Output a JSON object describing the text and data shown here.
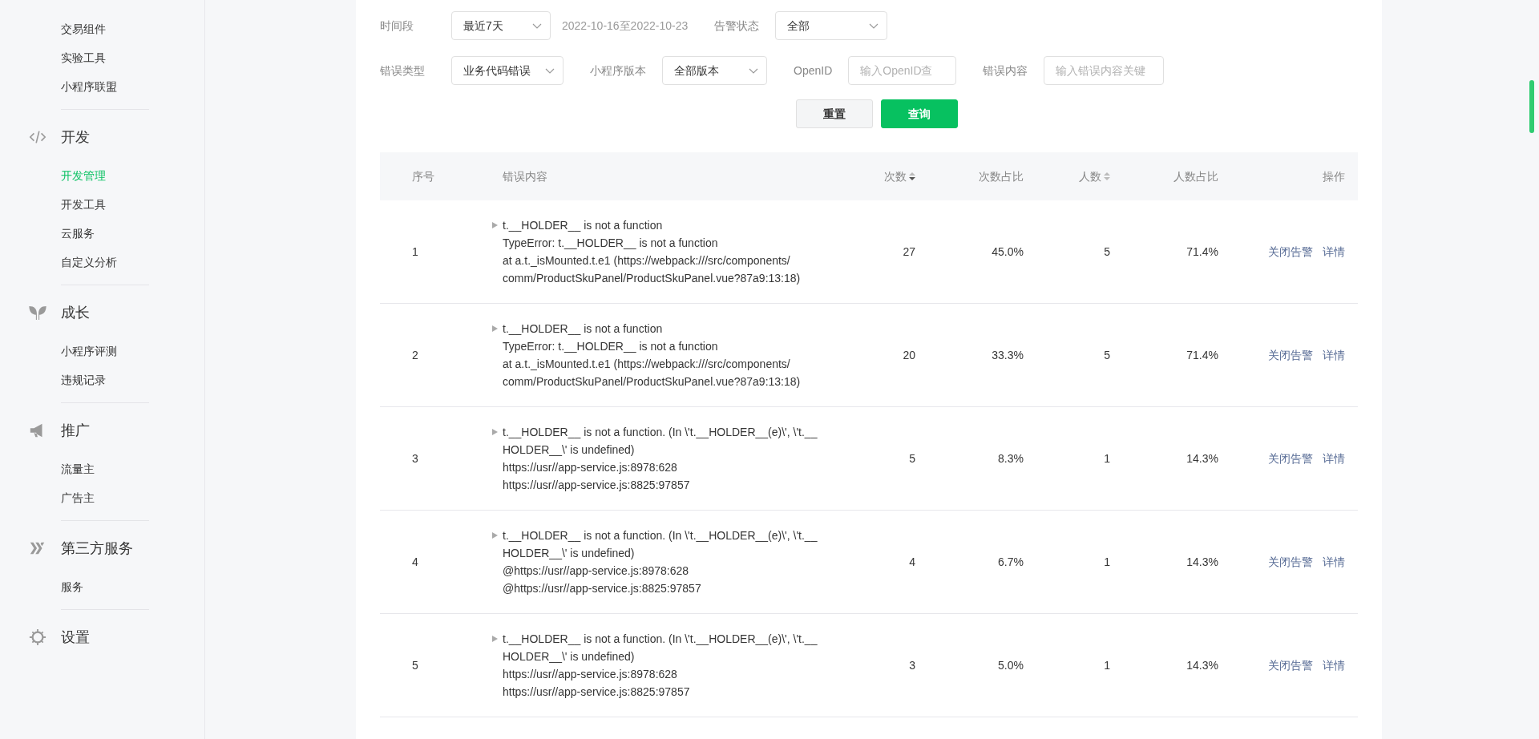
{
  "sidebar": {
    "groups": [
      {
        "items": [
          {
            "label": "交易组件",
            "selected": false
          },
          {
            "label": "实验工具",
            "selected": false
          },
          {
            "label": "小程序联盟",
            "selected": false
          }
        ]
      },
      {
        "kind": "code",
        "title": "开发",
        "items": [
          {
            "label": "开发管理",
            "selected": true
          },
          {
            "label": "开发工具",
            "selected": false
          },
          {
            "label": "云服务",
            "selected": false
          },
          {
            "label": "自定义分析",
            "selected": false
          }
        ]
      },
      {
        "kind": "sprout",
        "title": "成长",
        "items": [
          {
            "label": "小程序评测",
            "selected": false
          },
          {
            "label": "违规记录",
            "selected": false
          }
        ]
      },
      {
        "kind": "megaphone",
        "title": "推广",
        "items": [
          {
            "label": "流量主",
            "selected": false
          },
          {
            "label": "广告主",
            "selected": false
          }
        ]
      },
      {
        "kind": "service",
        "title": "第三方服务",
        "items": [
          {
            "label": "服务",
            "selected": false
          }
        ]
      },
      {
        "kind": "gear",
        "title": "设置"
      }
    ]
  },
  "filters": [
    [
      {
        "kind": "select",
        "label": "时间段",
        "value": "最近7天"
      },
      {
        "kind": "note",
        "text": "2022-10-16至2022-10-23"
      },
      {
        "kind": "select",
        "label": "告警状态",
        "value": "全部"
      }
    ],
    [
      {
        "kind": "select",
        "label": "错误类型",
        "value": "业务代码错误"
      },
      {
        "kind": "select",
        "label": "小程序版本",
        "value": "全部版本"
      },
      {
        "kind": "input",
        "label": "OpenID",
        "placeholder": "输入OpenID查"
      },
      {
        "kind": "input",
        "label": "错误内容",
        "placeholder": "输入错误内容关键"
      }
    ]
  ],
  "buttons": [
    {
      "label": "重置",
      "kind": "secondary"
    },
    {
      "label": "查询",
      "kind": "primary"
    }
  ],
  "table": {
    "columns": [
      {
        "label": "序号"
      },
      {
        "label": "错误内容"
      },
      {
        "label": "次数",
        "sorted": true
      },
      {
        "label": "次数占比"
      },
      {
        "label": "人数",
        "sorted": false
      },
      {
        "label": "人数占比"
      },
      {
        "label": "操作"
      }
    ],
    "rows": [
      {
        "index": "1",
        "error_lines": [
          "t.__HOLDER__ is not a function",
          "TypeError: t.__HOLDER__ is not a function",
          "at a.t._isMounted.t.e1 (https://webpack:///src/components/",
          "comm/ProductSkuPanel/ProductSkuPanel.vue?87a9:13:18)"
        ],
        "count": "27",
        "count_ratio": "45.0%",
        "users": "5",
        "users_ratio": "71.4%",
        "actions": [
          "关闭告警",
          "详情"
        ]
      },
      {
        "index": "2",
        "error_lines": [
          "t.__HOLDER__ is not a function",
          "TypeError: t.__HOLDER__ is not a function",
          "at a.t._isMounted.t.e1 (https://webpack:///src/components/",
          "comm/ProductSkuPanel/ProductSkuPanel.vue?87a9:13:18)"
        ],
        "count": "20",
        "count_ratio": "33.3%",
        "users": "5",
        "users_ratio": "71.4%",
        "actions": [
          "关闭告警",
          "详情"
        ]
      },
      {
        "index": "3",
        "error_lines": [
          "t.__HOLDER__ is not a function. (In \\'t.__HOLDER__(e)\\', \\'t.__",
          "HOLDER__\\' is undefined)",
          "https://usr//app-service.js:8978:628",
          "https://usr//app-service.js:8825:97857"
        ],
        "count": "5",
        "count_ratio": "8.3%",
        "users": "1",
        "users_ratio": "14.3%",
        "actions": [
          "关闭告警",
          "详情"
        ]
      },
      {
        "index": "4",
        "error_lines": [
          "t.__HOLDER__ is not a function. (In \\'t.__HOLDER__(e)\\', \\'t.__",
          "HOLDER__\\' is undefined)",
          "@https://usr//app-service.js:8978:628",
          "@https://usr//app-service.js:8825:97857"
        ],
        "count": "4",
        "count_ratio": "6.7%",
        "users": "1",
        "users_ratio": "14.3%",
        "actions": [
          "关闭告警",
          "详情"
        ]
      },
      {
        "index": "5",
        "error_lines": [
          "t.__HOLDER__ is not a function. (In \\'t.__HOLDER__(e)\\', \\'t.__",
          "HOLDER__\\' is undefined)",
          "https://usr//app-service.js:8978:628",
          "https://usr//app-service.js:8825:97857"
        ],
        "count": "3",
        "count_ratio": "5.0%",
        "users": "1",
        "users_ratio": "14.3%",
        "actions": [
          "关闭告警",
          "详情"
        ]
      }
    ]
  }
}
